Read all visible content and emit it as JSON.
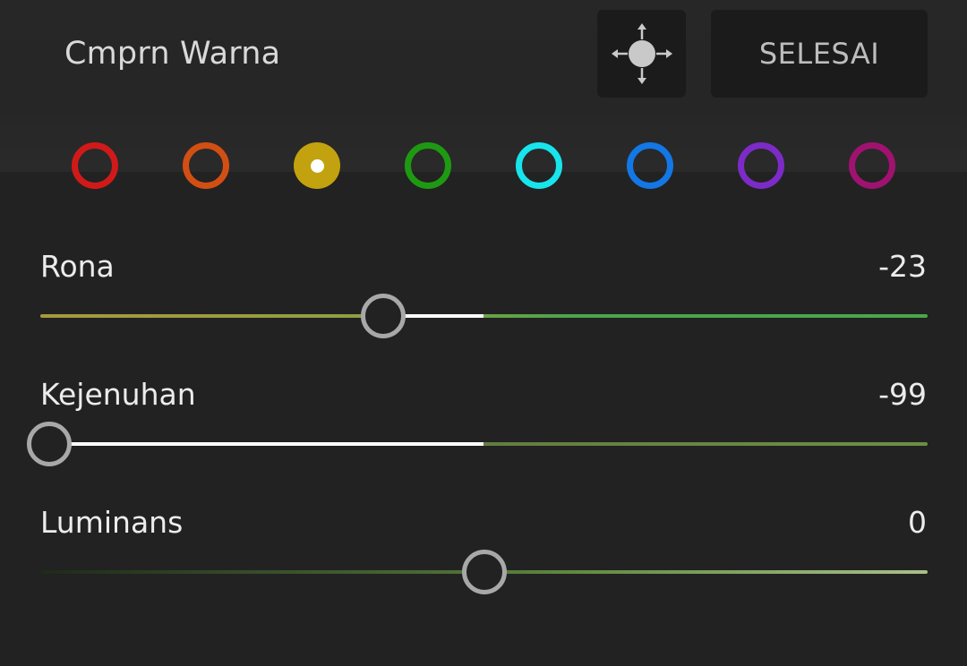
{
  "header": {
    "title": "Cmprn Warna",
    "done_label": "SELESAI"
  },
  "swatches": [
    {
      "name": "red",
      "color": "#d01a1a",
      "selected": false
    },
    {
      "name": "orange",
      "color": "#d24f14",
      "selected": false
    },
    {
      "name": "yellow",
      "color": "#c2a20f",
      "selected": true
    },
    {
      "name": "green",
      "color": "#1e9a12",
      "selected": false
    },
    {
      "name": "aqua",
      "color": "#18e4ec",
      "selected": false
    },
    {
      "name": "blue",
      "color": "#1377e6",
      "selected": false
    },
    {
      "name": "purple",
      "color": "#7d2bc8",
      "selected": false
    },
    {
      "name": "magenta",
      "color": "#a01270",
      "selected": false
    }
  ],
  "sliders": {
    "hue": {
      "label": "Rona",
      "value": "-23",
      "min": -100,
      "max": 100,
      "current": -23
    },
    "saturation": {
      "label": "Kejenuhan",
      "value": "-99",
      "min": -100,
      "max": 100,
      "current": -99
    },
    "luminance": {
      "label": "Luminans",
      "value": "0",
      "min": -100,
      "max": 100,
      "current": 0
    }
  }
}
